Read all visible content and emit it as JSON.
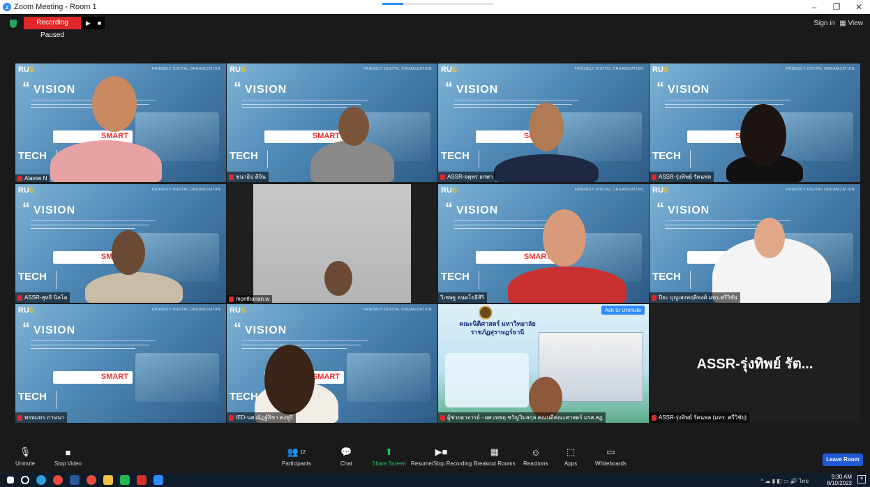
{
  "window": {
    "title": "Zoom Meeting - Room 1",
    "min": "–",
    "restore": "❐",
    "close": "✕"
  },
  "top": {
    "recording": "Recording Paused",
    "rec_resume_icon": "▶",
    "rec_stop_icon": "■",
    "signin": "Sign in",
    "view": "View"
  },
  "slide": {
    "vision": "VISION",
    "quote": "“",
    "tech": "TECH",
    "brand_r": "RU",
    "brand_s": "S",
    "friendly": "FRIENDLY DIGITAL ORGANIZATION"
  },
  "tiles": [
    {
      "name": "Alavee N"
    },
    {
      "name": "ชนาธิป ดีจิน"
    },
    {
      "name": "ASSR-จตุพร ยกพา"
    },
    {
      "name": "ASSR-รุ่งทิพย์ รัตนพล"
    },
    {
      "name": "ASSR-สุทธิ นิลโล"
    },
    {
      "name": "monthanan.w"
    },
    {
      "name": "วิเชษฐ ธนตโยธิสิริ"
    },
    {
      "name": "ปิยะ บุญเสงพฤติพงศ์ มทร.ศรีวิชัย"
    },
    {
      "name": "พรหมทร ภาษนา"
    },
    {
      "name": "IED-นส.ณัฏฐ์ธิชา คงพูรี"
    },
    {
      "name": "ผู้ช่วยอาจารย์ - ผศ.เทพฤ ชวัญวิมลกุล คณบดีคณะศาสตร์ มรส.สฎ"
    },
    {
      "name": "ASSR-รุ่งทิพย์ รัตนพล (มทร. ศรีวิชัย)"
    }
  ],
  "big_name": "ASSR-รุ่งทิพย์ รัต...",
  "ask_unmute": "Ask to Unmute",
  "faculty_title": "คณะนิติศาสตร์ มหาวิทยาลัยราชภัฏสุราษฎร์ธานี",
  "toolbar": {
    "unmute": "Unmute",
    "stop_video": "Stop Video",
    "participants": "Participants",
    "participants_count": "12",
    "chat": "Chat",
    "share": "Share Screen",
    "record": "Resume/Stop Recording",
    "breakout": "Breakout Rooms",
    "reactions": "Reactions",
    "apps": "Apps",
    "whiteboards": "Whiteboards",
    "leave": "Leave Room"
  },
  "taskbar": {
    "time": "9:30 AM",
    "date": "8/10/2023",
    "lang": "ไทย"
  },
  "colors": {
    "accent": "#2d8cff",
    "recording": "#e02828",
    "leave": "#1f5ad6",
    "active_border": "#e0e050"
  }
}
